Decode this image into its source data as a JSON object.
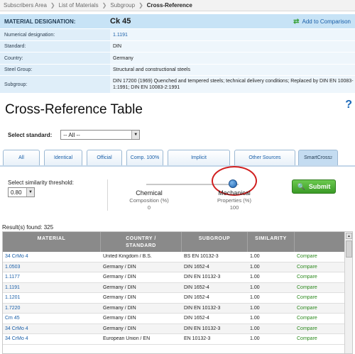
{
  "breadcrumb": [
    {
      "label": "Subscribers Area"
    },
    {
      "label": "List of Materials"
    },
    {
      "label": "Subgroup"
    },
    {
      "label": "Cross-Reference"
    }
  ],
  "material": {
    "designation_label": "MATERIAL DESIGNATION:",
    "designation_value": "Ck 45",
    "add_compare": "Add to Comparison",
    "rows": [
      {
        "label": "Numerical designation:",
        "value": "1.1191"
      },
      {
        "label": "Standard:",
        "value": "DIN"
      },
      {
        "label": "Country:",
        "value": "Germany"
      },
      {
        "label": "Steel Group:",
        "value": "Structural and constructional steels"
      },
      {
        "label": "Subgroup:",
        "value": "DIN 17200 (1969) Quenched and tempered steels; technical delivery conditions; Replaced by DIN EN 10083-1:1991; DIN EN 10083-2:1991"
      }
    ]
  },
  "page_title": "Cross-Reference Table",
  "help": "?",
  "standard": {
    "label": "Select standard:",
    "value": "-- All --"
  },
  "tabs": [
    {
      "label": "All"
    },
    {
      "label": "Identical"
    },
    {
      "label": "Official"
    },
    {
      "label": "Comp. 100%"
    },
    {
      "label": "Implicit"
    },
    {
      "label": "Other Sources"
    },
    {
      "label": "SmartCross",
      "sup": "2"
    }
  ],
  "similarity": {
    "label": "Select similarity threshold:",
    "value": "0.80"
  },
  "slider": {
    "left_title": "Chemical",
    "left_sub": "Composition (%)",
    "left_value": "0",
    "right_title": "Mechanical",
    "right_sub": "Properties (%)",
    "right_value": "100"
  },
  "submit": "Submit",
  "results": "Result(s) found: 325",
  "table": {
    "headers": {
      "material": "MATERIAL",
      "country_l1": "COUNTRY /",
      "country_l2": "STANDARD",
      "subgroup": "SUBGROUP",
      "similarity": "SIMILARITY"
    },
    "compare_label": "Compare",
    "rows": [
      {
        "material": "34 CrMo 4",
        "country": "United Kingdom / B.S.",
        "subgroup": "BS EN 10132-3",
        "similarity": "1.00"
      },
      {
        "material": "1.0503",
        "country": "Germany / DIN",
        "subgroup": "DIN 1652-4",
        "similarity": "1.00"
      },
      {
        "material": "1.1177",
        "country": "Germany / DIN",
        "subgroup": "DIN EN 10132-3",
        "similarity": "1.00"
      },
      {
        "material": "1.1191",
        "country": "Germany / DIN",
        "subgroup": "DIN 1652-4",
        "similarity": "1.00"
      },
      {
        "material": "1.1201",
        "country": "Germany / DIN",
        "subgroup": "DIN 1652-4",
        "similarity": "1.00"
      },
      {
        "material": "1.7220",
        "country": "Germany / DIN",
        "subgroup": "DIN EN 10132-3",
        "similarity": "1.00"
      },
      {
        "material": "Cm 45",
        "country": "Germany / DIN",
        "subgroup": "DIN 1652-4",
        "similarity": "1.00"
      },
      {
        "material": "34 CrMo 4",
        "country": "Germany / DIN",
        "subgroup": "DIN EN 10132-3",
        "similarity": "1.00"
      },
      {
        "material": "34 CrMo 4",
        "country": "European Union / EN",
        "subgroup": "EN 10132-3",
        "similarity": "1.00"
      }
    ]
  },
  "colors": {
    "accent": "#1a5fa8",
    "submit": "#4caf35",
    "header_bg": "#c7e3f6",
    "table_header": "#8a8a8a",
    "highlight_ring": "#d11f1f"
  }
}
